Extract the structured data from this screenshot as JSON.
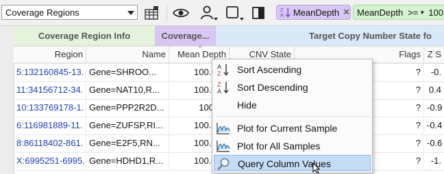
{
  "toolbar": {
    "view_select": {
      "value": "Coverage Regions"
    },
    "filters": [
      {
        "label": "MeanDepth",
        "color": "#d8c7f2"
      },
      {
        "field": "MeanDepth",
        "operator": ">=",
        "value": "100"
      }
    ]
  },
  "table": {
    "groups": [
      {
        "label": "Coverage Region Info",
        "color": "#e6f3dc"
      },
      {
        "label": "Coverage...",
        "color": "#d8c7f2"
      },
      {
        "label": "Target Copy Number State fo",
        "color": "#d9e9f8"
      }
    ],
    "columns": [
      "Region",
      "Name",
      "Mean Depth",
      "CNV State",
      "Flags",
      "Z S"
    ],
    "sort_indicator": "^",
    "rows": [
      {
        "region": "5:132160845-13.",
        "name": "Gene=SHROO...",
        "depth": "100.058",
        "cnv": "",
        "flags": "?",
        "z": "-0."
      },
      {
        "region": "11:34156712-34.",
        "name": "Gene=NAT10,R...",
        "depth": "100.058",
        "cnv": "",
        "flags": "?",
        "z": "0.4"
      },
      {
        "region": "10:133769178-1.",
        "name": "Gene=PPP2R2D...",
        "depth": "100.06",
        "cnv": "",
        "flags": "?",
        "z": "-0.9"
      },
      {
        "region": "6:116981889-11.",
        "name": "Gene=ZUFSP,RI...",
        "depth": "100.061",
        "cnv": "",
        "flags": "?",
        "z": "-0.4"
      },
      {
        "region": "8:86118402-861.",
        "name": "Gene=E2F5,RN...",
        "depth": "100.063",
        "cnv": "",
        "flags": "?",
        "z": "-0.6"
      },
      {
        "region": "X:6995251-6995.",
        "name": "Gene=HDHD1,R...",
        "depth": "100.064",
        "cnv": "",
        "flags": "?",
        "z": "-1."
      }
    ]
  },
  "context_menu": {
    "items": [
      {
        "label": "Sort Ascending",
        "icon": "sort-ascending-icon"
      },
      {
        "label": "Sort Descending",
        "icon": "sort-descending-icon"
      },
      {
        "label": "Hide",
        "icon": ""
      },
      {
        "label": "Plot for Current Sample",
        "icon": "plot-icon"
      },
      {
        "label": "Plot for All Samples",
        "icon": "plot-icon"
      },
      {
        "label": "Query Column Values",
        "icon": "magnifier-icon",
        "highlighted": true
      }
    ],
    "sort_icon_letters": {
      "a": "A",
      "z": "Z"
    }
  }
}
